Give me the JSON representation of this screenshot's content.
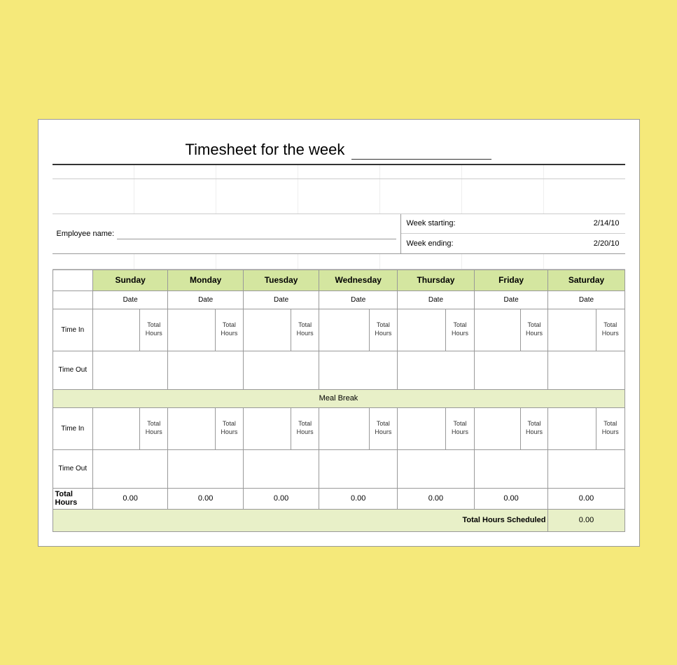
{
  "title": {
    "text": "Timesheet for the week",
    "underline_placeholder": ""
  },
  "employee": {
    "label": "Employee name:",
    "value": ""
  },
  "week": {
    "starting_label": "Week starting:",
    "starting_value": "2/14/10",
    "ending_label": "Week ending:",
    "ending_value": "2/20/10"
  },
  "days": [
    "Sunday",
    "Monday",
    "Tuesday",
    "Wednesday",
    "Thursday",
    "Friday",
    "Saturday"
  ],
  "date_label": "Date",
  "time_in_label": "Time In",
  "time_out_label": "Time Out",
  "total_hours_label": "Total\nHours",
  "meal_break_label": "Meal Break",
  "total_hours_row_label": "Total Hours",
  "total_hours_values": [
    "0.00",
    "0.00",
    "0.00",
    "0.00",
    "0.00",
    "0.00",
    "0.00"
  ],
  "grand_total_label": "Total Hours Scheduled",
  "grand_total_value": "0.00"
}
